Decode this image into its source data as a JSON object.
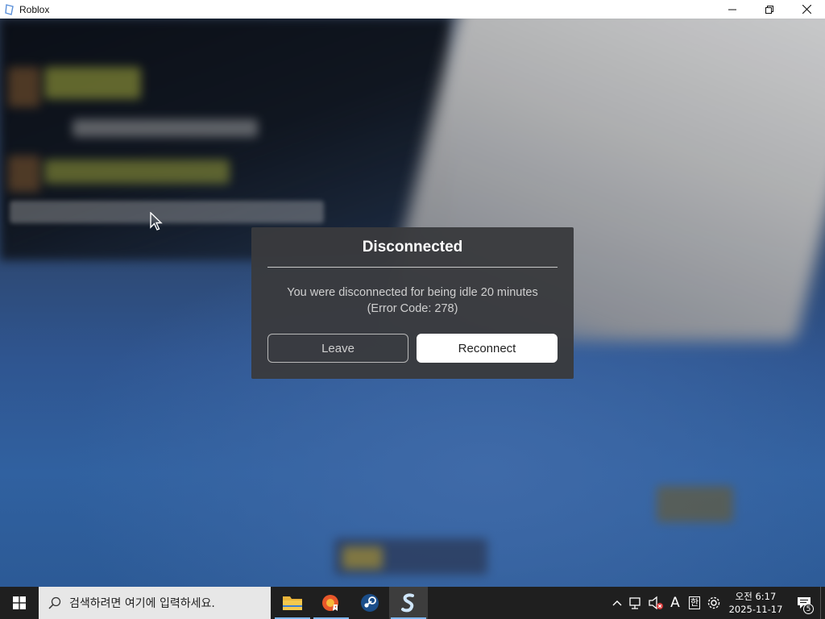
{
  "window": {
    "title": "Roblox",
    "icon": "roblox-icon"
  },
  "dialog": {
    "title": "Disconnected",
    "message_line1": "You were disconnected for being idle 20 minutes",
    "message_line2": "(Error Code: 278)",
    "leave_label": "Leave",
    "reconnect_label": "Reconnect"
  },
  "taskbar": {
    "search_placeholder": "검색하려면 여기에 입력하세요.",
    "apps": [
      "file-explorer-icon",
      "browser-icon",
      "steam-icon",
      "roblox-studio-icon"
    ],
    "tray": {
      "ime_letter": "A",
      "ime_lang": "한",
      "time": "오전 6:17",
      "date": "2025-11-17",
      "notification_count": "5"
    }
  },
  "colors": {
    "dialog_bg": "#393a3d",
    "reconnect_bg": "#ffffff",
    "taskbar_bg": "#1f1f1f"
  }
}
